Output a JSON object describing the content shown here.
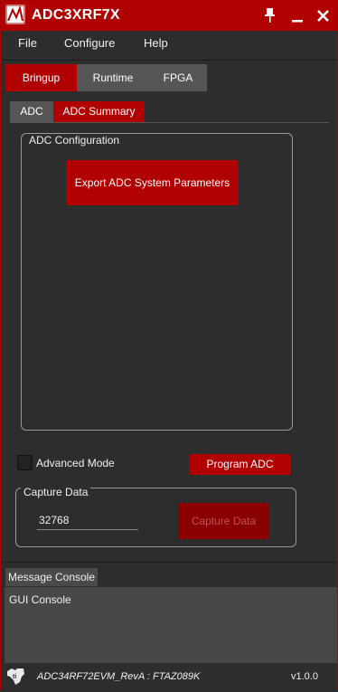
{
  "window": {
    "title": "ADC3XRF7X",
    "pin_glyph": "📌",
    "minimize_glyph": "_",
    "close_glyph": "✕"
  },
  "menu": {
    "items": [
      {
        "label": "File"
      },
      {
        "label": "Configure"
      },
      {
        "label": "Help"
      }
    ]
  },
  "main_tabs": [
    {
      "label": "Bringup",
      "active": true
    },
    {
      "label": "Runtime",
      "active": false
    },
    {
      "label": "FPGA",
      "active": false
    }
  ],
  "sub_tabs": [
    {
      "label": "ADC",
      "active": false
    },
    {
      "label": "ADC Summary",
      "active": true
    }
  ],
  "adc_configuration": {
    "title": "ADC Configuration",
    "export_button": "Export ADC System Parameters"
  },
  "advanced_mode": {
    "label": "Advanced Mode",
    "checked": false
  },
  "program_adc_button": "Program ADC",
  "capture": {
    "title": "Capture Data",
    "value": "32768",
    "button": "Capture Data"
  },
  "console": {
    "tab_label": "Message Console",
    "text": "GUI Console"
  },
  "status": {
    "device": "ADC34RF72EVM_RevA : FTAZ089K",
    "version": "v1.0.0"
  },
  "colors": {
    "accent": "#b00000",
    "background": "#2d2d2d",
    "tab_inactive": "#555555",
    "console_bg": "#474747"
  }
}
